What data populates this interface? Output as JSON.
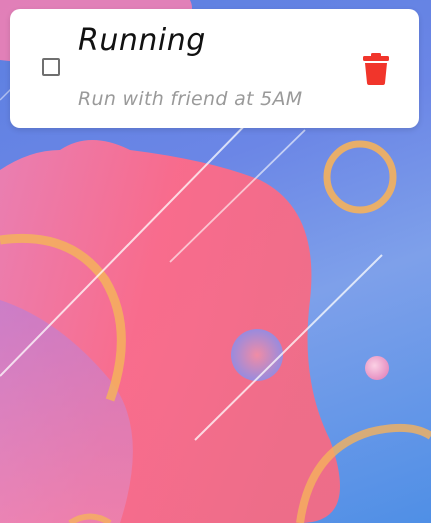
{
  "task": {
    "title": "Running",
    "description": "Run with friend at 5AM",
    "completed": false
  },
  "icons": {
    "checkbox": "checkbox-unchecked-icon",
    "delete": "trash-icon"
  },
  "colors": {
    "delete_icon": "#f1352b",
    "card_background": "#ffffff",
    "title_text": "#111111",
    "description_text": "#9a9a9a",
    "ring_color": "#f5b15c"
  }
}
